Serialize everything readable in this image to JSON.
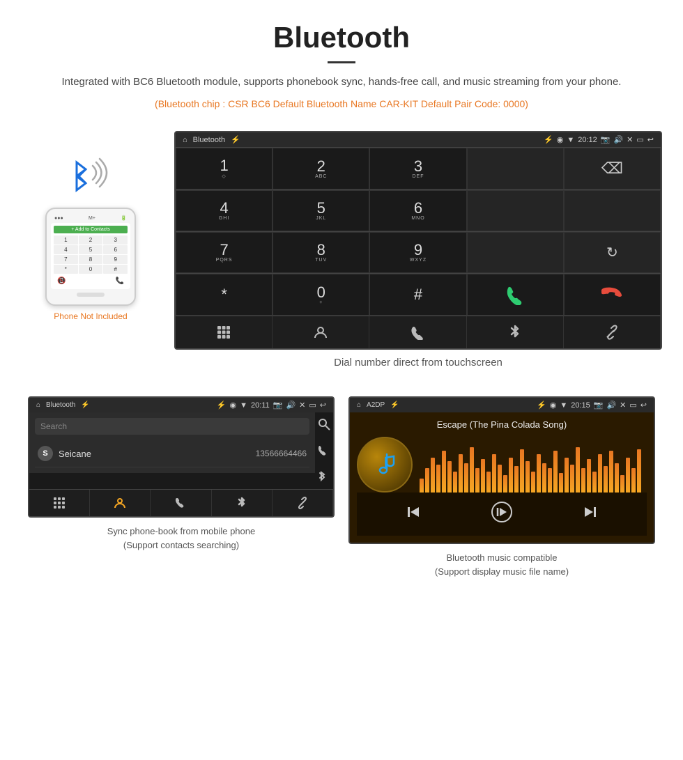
{
  "header": {
    "title": "Bluetooth",
    "description": "Integrated with BC6 Bluetooth module, supports phonebook sync, hands-free call, and music streaming from your phone.",
    "specs": "(Bluetooth chip : CSR BC6    Default Bluetooth Name CAR-KIT    Default Pair Code: 0000)"
  },
  "car_screen": {
    "status_bar": {
      "app_name": "Bluetooth",
      "time": "20:12"
    },
    "dialpad": [
      {
        "num": "1",
        "sub": ""
      },
      {
        "num": "2",
        "sub": "ABC"
      },
      {
        "num": "3",
        "sub": "DEF"
      },
      {
        "num": "",
        "sub": ""
      },
      {
        "num": "⌫",
        "sub": ""
      }
    ],
    "row2": [
      {
        "num": "4",
        "sub": "GHI"
      },
      {
        "num": "5",
        "sub": "JKL"
      },
      {
        "num": "6",
        "sub": "MNO"
      },
      {
        "num": "",
        "sub": ""
      },
      {
        "num": "",
        "sub": ""
      }
    ],
    "row3": [
      {
        "num": "7",
        "sub": "PQRS"
      },
      {
        "num": "8",
        "sub": "TUV"
      },
      {
        "num": "9",
        "sub": "WXYZ"
      },
      {
        "num": "",
        "sub": ""
      },
      {
        "num": "↻",
        "sub": ""
      }
    ],
    "row4": [
      {
        "num": "*",
        "sub": ""
      },
      {
        "num": "0",
        "sub": "+"
      },
      {
        "num": "#",
        "sub": ""
      },
      {
        "num": "📞",
        "sub": "green"
      },
      {
        "num": "📞",
        "sub": "red"
      }
    ]
  },
  "contacts_screen": {
    "status_bar": {
      "app_name": "Bluetooth",
      "time": "20:11"
    },
    "search_placeholder": "Search",
    "contact": {
      "letter": "S",
      "name": "Seicane",
      "phone": "13566664466"
    }
  },
  "music_screen": {
    "status_bar": {
      "app_name": "A2DP",
      "time": "20:15"
    },
    "song_title": "Escape (The Pina Colada Song)"
  },
  "captions": {
    "dialpad": "Dial number direct from touchscreen",
    "contacts": "Sync phone-book from mobile phone\n(Support contacts searching)",
    "music": "Bluetooth music compatible\n(Support display music file name)"
  },
  "phone_not_included": "Phone Not Included"
}
